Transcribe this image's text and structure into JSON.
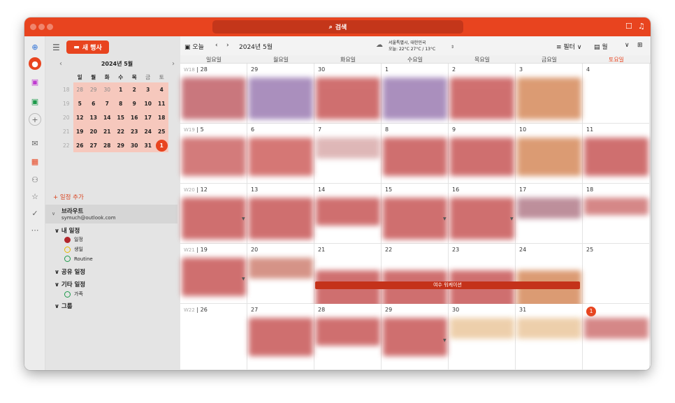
{
  "window": {
    "search_label": "검색"
  },
  "sidebar": {
    "new_event_label": "새 행사",
    "mini_cal": {
      "title": "2024년 5월",
      "dow": [
        "일",
        "월",
        "화",
        "수",
        "목",
        "금",
        "토"
      ],
      "weeks": [
        [
          "18",
          "28",
          "29",
          "30",
          "1",
          "2",
          "3",
          "4"
        ],
        [
          "19",
          "5",
          "6",
          "7",
          "8",
          "9",
          "10",
          "11"
        ],
        [
          "20",
          "12",
          "13",
          "14",
          "15",
          "16",
          "17",
          "18"
        ],
        [
          "21",
          "19",
          "20",
          "21",
          "22",
          "23",
          "24",
          "25"
        ],
        [
          "22",
          "26",
          "27",
          "28",
          "29",
          "30",
          "31",
          "1"
        ]
      ]
    },
    "add_event_label": "일정 추가",
    "account": {
      "name": "브라우트",
      "email": "symuch@outlook.com"
    },
    "groups": {
      "my": "내 일정",
      "shared": "공유 일정",
      "other": "기타 일정",
      "group": "그룹"
    },
    "calendars": {
      "c1": "일정",
      "c2": "생일",
      "c3": "Routine",
      "c4": "가족"
    }
  },
  "toolbar": {
    "today": "오늘",
    "month_title": "2024년 5월",
    "weather_city": "서울특별시, 대한민국",
    "weather_now": "오늘: 22°C  27°C / 13°C",
    "filter": "필터",
    "view": "월"
  },
  "day_headers": [
    "일요일",
    "월요일",
    "화요일",
    "수요일",
    "목요일",
    "금요일",
    "토요일"
  ],
  "weeks": [
    {
      "wk": "W18",
      "days": [
        "28",
        "29",
        "30",
        "1",
        "2",
        "3",
        "4"
      ]
    },
    {
      "wk": "W19",
      "days": [
        "5",
        "6",
        "7",
        "8",
        "9",
        "10",
        "11"
      ]
    },
    {
      "wk": "W20",
      "days": [
        "12",
        "13",
        "14",
        "15",
        "16",
        "17",
        "18"
      ]
    },
    {
      "wk": "W21",
      "days": [
        "19",
        "20",
        "21",
        "22",
        "23",
        "24",
        "25"
      ]
    },
    {
      "wk": "W22",
      "days": [
        "26",
        "27",
        "28",
        "29",
        "30",
        "31",
        "1"
      ]
    }
  ],
  "event_banner": "여수 워케이션",
  "colors": {
    "accent": "#e8441f",
    "event": "#c4321a"
  }
}
